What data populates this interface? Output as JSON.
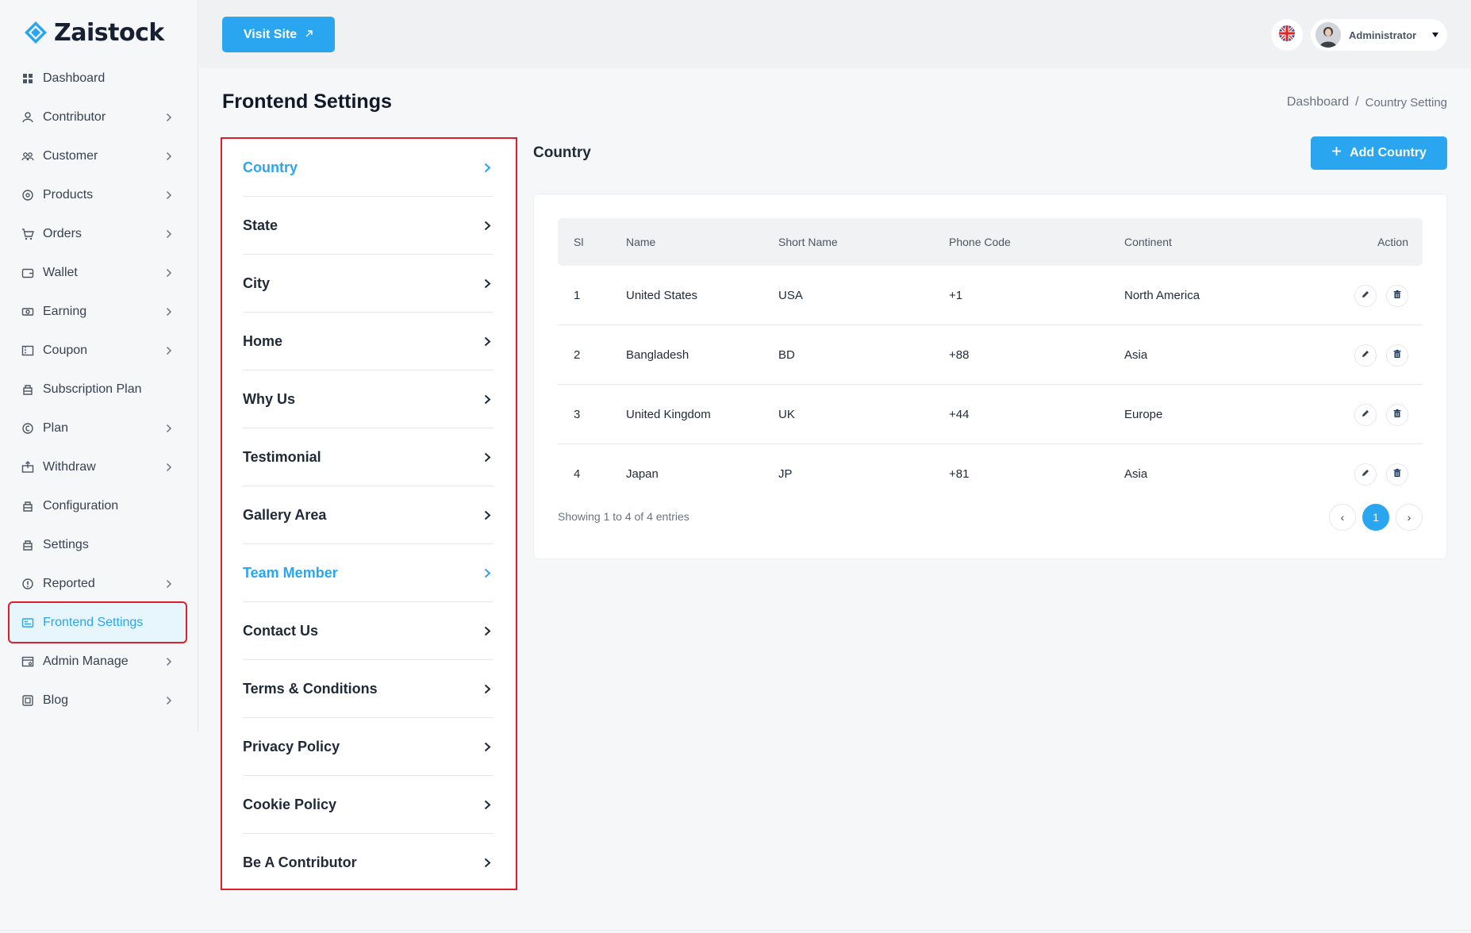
{
  "brand": {
    "name": "Zaistock",
    "accent": "#29a6ef",
    "highlight_border": "#e11d2a"
  },
  "sidebar": {
    "items": [
      {
        "label": "Dashboard",
        "icon": "dashboard-icon",
        "has_submenu": false
      },
      {
        "label": "Contributor",
        "icon": "contributor-icon",
        "has_submenu": true
      },
      {
        "label": "Customer",
        "icon": "customer-icon",
        "has_submenu": true
      },
      {
        "label": "Products",
        "icon": "products-icon",
        "has_submenu": true
      },
      {
        "label": "Orders",
        "icon": "cart-icon",
        "has_submenu": true
      },
      {
        "label": "Wallet",
        "icon": "wallet-icon",
        "has_submenu": true
      },
      {
        "label": "Earning",
        "icon": "earning-icon",
        "has_submenu": true
      },
      {
        "label": "Coupon",
        "icon": "coupon-icon",
        "has_submenu": true
      },
      {
        "label": "Subscription Plan",
        "icon": "subscription-icon",
        "has_submenu": false
      },
      {
        "label": "Plan",
        "icon": "plan-icon",
        "has_submenu": true
      },
      {
        "label": "Withdraw",
        "icon": "withdraw-icon",
        "has_submenu": true
      },
      {
        "label": "Configuration",
        "icon": "configuration-icon",
        "has_submenu": false
      },
      {
        "label": "Settings",
        "icon": "settings-icon",
        "has_submenu": false
      },
      {
        "label": "Reported",
        "icon": "reported-icon",
        "has_submenu": true
      },
      {
        "label": "Frontend Settings",
        "icon": "frontend-icon",
        "has_submenu": false,
        "active": true
      },
      {
        "label": "Admin Manage",
        "icon": "admin-icon",
        "has_submenu": true
      },
      {
        "label": "Blog",
        "icon": "blog-icon",
        "has_submenu": true
      }
    ]
  },
  "topbar": {
    "visit_label": "Visit Site",
    "user_name": "Administrator",
    "language_icon": "uk-flag-icon"
  },
  "page": {
    "title": "Frontend Settings",
    "breadcrumb": {
      "home": "Dashboard",
      "separator": "/",
      "current": "Country Setting"
    }
  },
  "settings_menu": {
    "items": [
      {
        "label": "Country",
        "highlight": true
      },
      {
        "label": "State",
        "highlight": false
      },
      {
        "label": "City",
        "highlight": false
      },
      {
        "label": "Home",
        "highlight": false
      },
      {
        "label": "Why Us",
        "highlight": false
      },
      {
        "label": "Testimonial",
        "highlight": false
      },
      {
        "label": "Gallery Area",
        "highlight": false
      },
      {
        "label": "Team Member",
        "highlight": true
      },
      {
        "label": "Contact Us",
        "highlight": false
      },
      {
        "label": "Terms & Conditions",
        "highlight": false
      },
      {
        "label": "Privacy Policy",
        "highlight": false
      },
      {
        "label": "Cookie Policy",
        "highlight": false
      },
      {
        "label": "Be A Contributor",
        "highlight": false
      }
    ]
  },
  "country": {
    "section_title": "Country",
    "add_label": "Add Country",
    "columns": {
      "sl": "Sl",
      "name": "Name",
      "short_name": "Short Name",
      "phone_code": "Phone Code",
      "continent": "Continent",
      "action": "Action"
    },
    "rows": [
      {
        "sl": "1",
        "name": "United States",
        "short_name": "USA",
        "phone_code": "+1",
        "continent": "North America"
      },
      {
        "sl": "2",
        "name": "Bangladesh",
        "short_name": "BD",
        "phone_code": "+88",
        "continent": "Asia"
      },
      {
        "sl": "3",
        "name": "United Kingdom",
        "short_name": "UK",
        "phone_code": "+44",
        "continent": "Europe"
      },
      {
        "sl": "4",
        "name": "Japan",
        "short_name": "JP",
        "phone_code": "+81",
        "continent": "Asia"
      }
    ],
    "footer": "Showing 1 to 4 of 4 entries",
    "pagination": {
      "prev": "‹",
      "current": "1",
      "next": "›"
    }
  }
}
